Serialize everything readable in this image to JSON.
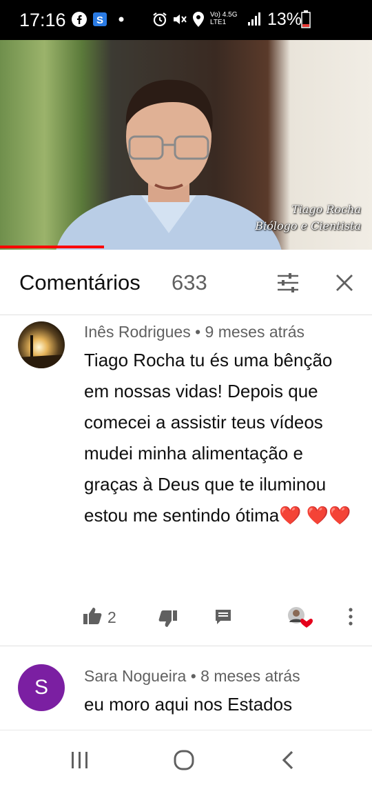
{
  "status_bar": {
    "time": "17:16",
    "battery": "13%",
    "icons": [
      "facebook-icon",
      "app-s-icon",
      "dot-icon",
      "alarm-icon",
      "mute-icon",
      "location-icon",
      "volte-icon",
      "signal-icon",
      "battery-icon"
    ],
    "network_top": "Vo) 4.5G",
    "network_bottom": "LTE1"
  },
  "video": {
    "caption_name": "Tiago Rocha",
    "caption_role": "Biólogo e Cientista",
    "progress_fraction": 0.28,
    "progress_color": "#ff0000"
  },
  "comments_header": {
    "title": "Comentários",
    "count": "633",
    "filter_icon": "sort-filter-icon",
    "close_icon": "close-icon"
  },
  "comments": [
    {
      "author": "Inês Rodrigues",
      "time": "9 meses atrás",
      "text": "Tiago Rocha tu és uma bênção em nossas vidas! Depois que comecei a assistir teus vídeos mudei minha alimentação e graças à Deus que te iluminou estou me sentindo ótima❤️ ❤️❤️",
      "likes": "2",
      "avatar": "sunset-photo-avatar",
      "creator_heart": true
    },
    {
      "author": "Sara Nogueira",
      "time": "8 meses atrás",
      "text": "eu moro aqui nos Estados",
      "avatar_letter": "S",
      "avatar_color": "#7b1fa2"
    }
  ],
  "nav_bar": {
    "icons": [
      "recents-icon",
      "home-icon",
      "back-icon"
    ]
  }
}
